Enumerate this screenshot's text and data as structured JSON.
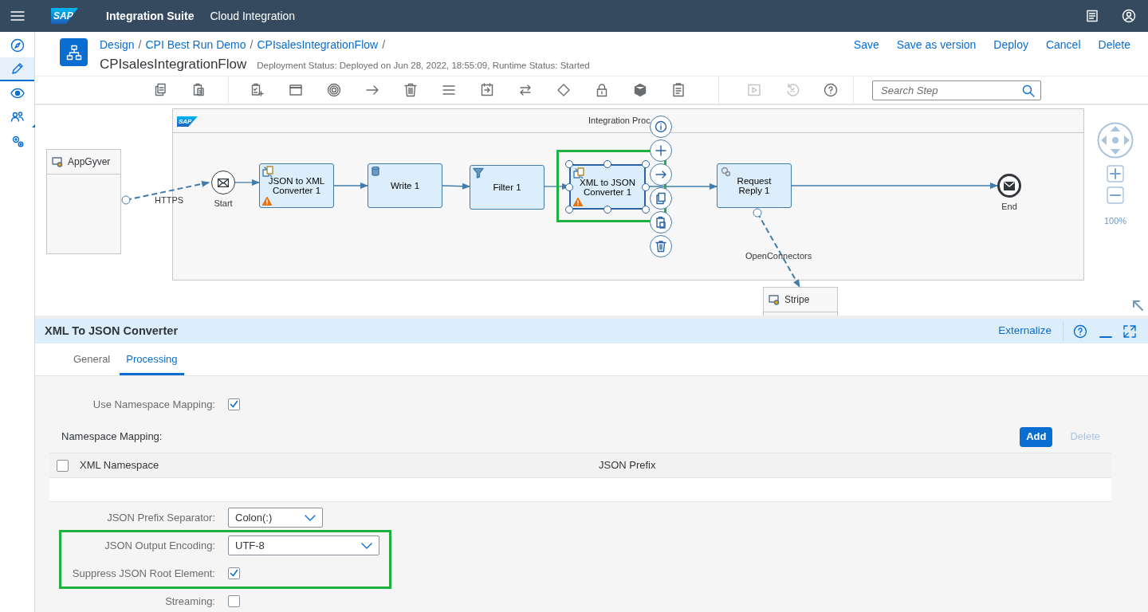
{
  "shell": {
    "logo": "SAP",
    "title": "Integration Suite",
    "subtitle": "Cloud Integration"
  },
  "nav_items": [
    {
      "kind": "discover",
      "selected": false
    },
    {
      "kind": "design",
      "selected": true
    },
    {
      "kind": "monitor",
      "selected": false
    },
    {
      "kind": "users",
      "selected": false
    },
    {
      "kind": "settings",
      "selected": false
    }
  ],
  "header": {
    "breadcrumbs": [
      "Design",
      "CPI Best Run Demo",
      "CPIsalesIntegrationFlow"
    ],
    "separator": "/",
    "title": "CPIsalesIntegrationFlow",
    "status": "Deployment Status: Deployed on Jun 28, 2022, 18:55:09, Runtime Status: Started",
    "actions": [
      "Save",
      "Save as version",
      "Deploy",
      "Cancel",
      "Delete"
    ]
  },
  "toolbar": {
    "groups": [
      [
        {
          "kind": "copy",
          "disabled": false
        },
        {
          "kind": "paste",
          "disabled": false
        }
      ],
      [
        {
          "kind": "add-step",
          "disabled": false
        },
        {
          "kind": "window",
          "disabled": false
        },
        {
          "kind": "target",
          "disabled": false
        },
        {
          "kind": "arrow",
          "disabled": false
        },
        {
          "kind": "delete",
          "disabled": false
        },
        {
          "kind": "lines",
          "disabled": false
        },
        {
          "kind": "import",
          "disabled": false
        },
        {
          "kind": "swap",
          "disabled": false
        },
        {
          "kind": "diamond",
          "disabled": false
        },
        {
          "kind": "lock",
          "disabled": false
        },
        {
          "kind": "cube",
          "disabled": false
        },
        {
          "kind": "clipboard",
          "disabled": false
        }
      ],
      [
        {
          "kind": "play",
          "disabled": true
        },
        {
          "kind": "undo",
          "disabled": true
        },
        {
          "kind": "help",
          "disabled": false
        }
      ]
    ],
    "search": {
      "placeholder": "Search Step"
    }
  },
  "canvas": {
    "process": {
      "logo": "SAP",
      "title": "Integration Proc"
    },
    "participants": [
      {
        "label": "AppGyver"
      },
      {
        "label": "Stripe"
      }
    ],
    "events": [
      {
        "kind": "start",
        "label": "Start"
      },
      {
        "kind": "end",
        "label": "End"
      }
    ],
    "steps": [
      {
        "label": "JSON to XML Converter 1",
        "kind": "converter",
        "warning": true,
        "selected": false
      },
      {
        "label": "Write 1",
        "kind": "datastore",
        "warning": false,
        "selected": false
      },
      {
        "label": "Filter 1",
        "kind": "filter",
        "warning": false,
        "selected": false
      },
      {
        "label": "XML to JSON Converter 1",
        "kind": "converter",
        "warning": true,
        "selected": true
      },
      {
        "label": "Request Reply 1",
        "kind": "gear",
        "warning": false,
        "selected": false
      }
    ],
    "connection_labels": [
      "HTTPS",
      "OpenConnectors"
    ],
    "zoom": "100%"
  },
  "panel": {
    "title": "XML To JSON Converter",
    "externalize": "Externalize",
    "tabs": [
      {
        "label": "General",
        "selected": false
      },
      {
        "label": "Processing",
        "selected": true
      }
    ],
    "use_namespace_mapping": {
      "label": "Use Namespace Mapping:",
      "checked": true
    },
    "namespace_mapping": {
      "label": "Namespace Mapping:",
      "add": "Add",
      "delete": "Delete",
      "delete_disabled": true,
      "columns": [
        "XML Namespace",
        "JSON Prefix"
      ],
      "all_checked": false
    },
    "fields": [
      {
        "kind": "select",
        "label": "JSON Prefix Separator:",
        "value": "Colon(:)",
        "highlighted": false
      },
      {
        "kind": "select",
        "label": "JSON Output Encoding:",
        "value": "UTF-8",
        "highlighted": true
      },
      {
        "kind": "checkbox",
        "label": "Suppress JSON Root Element:",
        "checked": true,
        "highlighted": true
      },
      {
        "kind": "checkbox",
        "label": "Streaming:",
        "checked": false,
        "highlighted": false
      }
    ]
  }
}
